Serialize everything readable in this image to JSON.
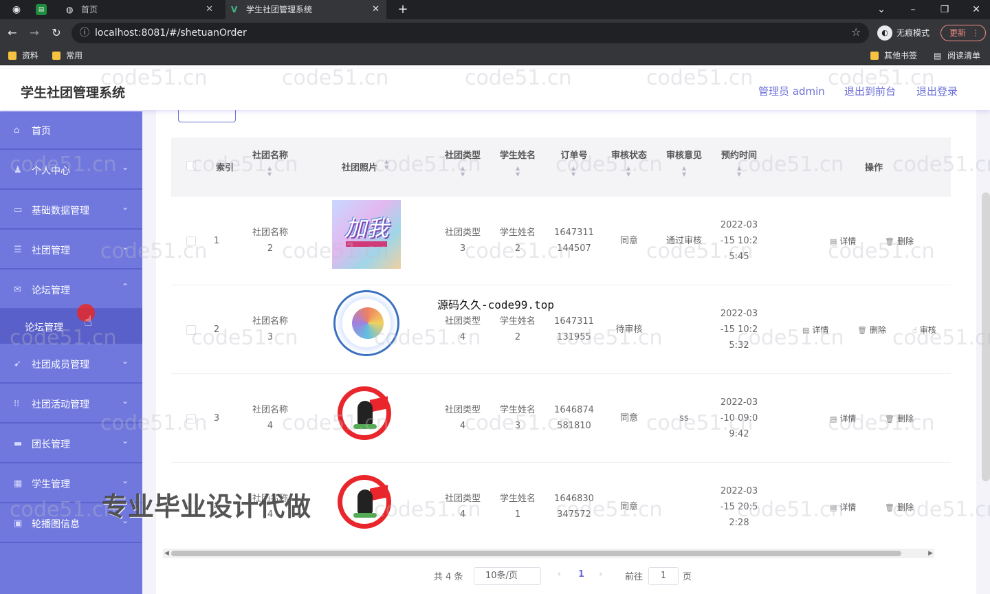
{
  "browser": {
    "tabs": [
      {
        "label": "首页"
      },
      {
        "label": "学生社团管理系统"
      }
    ],
    "url": "localhost:8081/#/shetuanOrder",
    "incognito_label": "无痕模式",
    "update_label": "更新",
    "bookmarks": [
      "资料",
      "常用"
    ],
    "other_bookmarks": "其他书签",
    "reading_list": "阅读清单"
  },
  "header": {
    "title": "学生社团管理系统",
    "user": "管理员 admin",
    "to_front": "退出到前台",
    "logout": "退出登录"
  },
  "sidebar": {
    "items": [
      {
        "label": "首页",
        "icon": "home-icon"
      },
      {
        "label": "个人中心",
        "icon": "user-icon"
      },
      {
        "label": "基础数据管理",
        "icon": "box-icon"
      },
      {
        "label": "社团管理",
        "icon": "list-icon"
      },
      {
        "label": "论坛管理",
        "icon": "chat-icon"
      },
      {
        "label": "社团成员管理",
        "icon": "send-icon"
      },
      {
        "label": "社团活动管理",
        "icon": "grid-icon"
      },
      {
        "label": "团长管理",
        "icon": "card-icon"
      },
      {
        "label": "学生管理",
        "icon": "table-icon"
      },
      {
        "label": "轮播图信息",
        "icon": "image-icon"
      }
    ],
    "active_sub": "论坛管理"
  },
  "table": {
    "headers": {
      "index": "索引",
      "club_name": "社团名称",
      "club_photo": "社团照片",
      "club_type": "社团类型",
      "student_name": "学生姓名",
      "order_no": "订单号",
      "review_status": "审核状态",
      "review_comment": "审核意见",
      "booking_time": "预约时间",
      "actions": "操作"
    },
    "rows": [
      {
        "index": "1",
        "club_name": [
          "社团名称",
          "2"
        ],
        "club_type": [
          "社团类型",
          "3"
        ],
        "student_name": [
          "学生姓名",
          "2"
        ],
        "order_no": [
          "1647311",
          "144507"
        ],
        "status": "同意",
        "comment": "通过审核",
        "time": [
          "2022-03",
          "-15 10:2",
          "5:45"
        ],
        "photo": "join-us-poster"
      },
      {
        "index": "2",
        "club_name": [
          "社团名称",
          "3"
        ],
        "club_type": [
          "社团类型",
          "4"
        ],
        "student_name": [
          "学生姓名",
          "2"
        ],
        "order_no": [
          "1647311",
          "131955"
        ],
        "status": "待审核",
        "comment": "",
        "time": [
          "2022-03",
          "-15 10:2",
          "5:32"
        ],
        "photo": "school-logo"
      },
      {
        "index": "3",
        "club_name": [
          "社团名称",
          "4"
        ],
        "club_type": [
          "社团类型",
          "4"
        ],
        "student_name": [
          "学生姓名",
          "3"
        ],
        "order_no": [
          "1646874",
          "581810"
        ],
        "status": "同意",
        "comment": "ss",
        "time": [
          "2022-03",
          "-10 09:0",
          "9:42"
        ],
        "photo": "red-badge"
      },
      {
        "index": "4",
        "club_name": [
          "社团名称",
          "4"
        ],
        "club_type": [
          "社团类型",
          "4"
        ],
        "student_name": [
          "学生姓名",
          "1"
        ],
        "order_no": [
          "1646830",
          "347572"
        ],
        "status": "同意",
        "comment": "",
        "time": [
          "2022-03",
          "-15 20:5",
          "2:28"
        ],
        "photo": "red-badge"
      }
    ],
    "actions": {
      "detail": "详情",
      "delete": "删除",
      "review": "审核"
    }
  },
  "pagination": {
    "total": "共 4 条",
    "page_size": "10条/页",
    "current": "1",
    "goto_label": "前往",
    "goto_value": "1",
    "page_unit": "页"
  },
  "overlays": {
    "source_text": "源码久久-code99.top",
    "promo_text": "专业毕业设计代做",
    "watermark": "code51.cn"
  },
  "colors": {
    "sidebar": "#7078de",
    "accent": "#6a6fd6"
  }
}
